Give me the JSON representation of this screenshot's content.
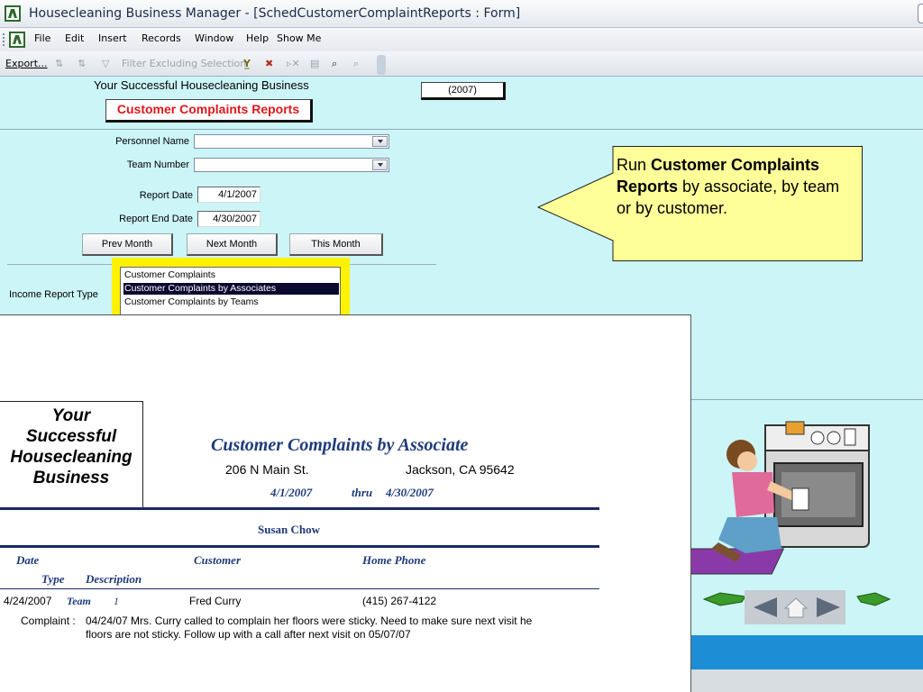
{
  "window": {
    "title": "Housecleaning Business Manager - [SchedCustomerComplaintReports : Form]"
  },
  "menu": {
    "items": [
      "File",
      "Edit",
      "Insert",
      "Records",
      "Window",
      "Help",
      "Show Me"
    ]
  },
  "toolbar": {
    "export_label": "Export...",
    "filter_label": "Filter Excluding Selection"
  },
  "form": {
    "business_name": "Your Successful Housecleaning Business",
    "year_badge": "(2007)",
    "title": "Customer Complaints Reports",
    "personnel_label": "Personnel Name",
    "personnel_value": "",
    "team_label": "Team Number",
    "team_value": "",
    "report_date_label": "Report Date",
    "report_date_value": "4/1/2007",
    "report_end_label": "Report End Date",
    "report_end_value": "4/30/2007",
    "prev_month": "Prev Month",
    "next_month": "Next Month",
    "this_month": "This Month",
    "income_report_label": "Income Report Type",
    "report_types": [
      "Customer Complaints",
      "Customer Complaints by Associates",
      "Customer Complaints by Teams"
    ],
    "selected_report_type": "Customer Complaints by Associates"
  },
  "callout": {
    "prefix": "Run ",
    "bold": "Customer Complaints Reports",
    "suffix": " by associate, by team or by customer."
  },
  "report": {
    "logo_lines": [
      "Your",
      "Successful",
      "Housecleaning",
      "Business"
    ],
    "title": "Customer Complaints by Associate",
    "address": "206 N Main St.",
    "city": "Jackson, CA  95642",
    "start_date": "4/1/2007",
    "thru": "thru",
    "end_date": "4/30/2007",
    "associate": "Susan Chow",
    "col_date": "Date",
    "col_customer": "Customer",
    "col_phone": "Home Phone",
    "col_type": "Type",
    "col_description": "Description",
    "row": {
      "date": "4/24/2007",
      "team_label": "Team",
      "team_number": "1",
      "customer": "Fred Curry",
      "phone": "(415) 267-4122",
      "complaint_label": "Complaint :",
      "complaint_line1": "04/24/07 Mrs. Curry called to complain her floors were sticky. Need to make sure next visit he",
      "complaint_line2": "floors are not sticky. Follow up with a call after next visit on 05/07/07"
    }
  },
  "colors": {
    "form_bg": "#ccf5f7",
    "accent_red": "#e0161b",
    "report_navy": "#1e3a7a",
    "callout_fill": "#ffff99",
    "listbox_highlight": "#fff200",
    "blue_bar": "#1d8ed6"
  },
  "icons": [
    "access-app-icon",
    "sort-ascending-icon",
    "sort-descending-icon",
    "filter-icon",
    "find-icon",
    "prev-arrow-icon",
    "home-icon",
    "next-arrow-icon"
  ]
}
